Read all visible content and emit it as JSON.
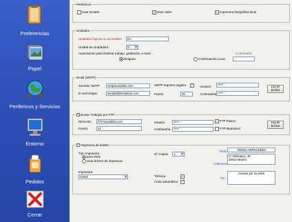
{
  "sidebar": {
    "items": [
      {
        "label": "Preferencias"
      },
      {
        "label": "Papel"
      },
      {
        "label": "Perifericos y Servicios"
      },
      {
        "label": "Entorno"
      },
      {
        "label": "Pedidos"
      },
      {
        "label": "Cerrar"
      }
    ]
  },
  "perifericos": {
    "title": "Perifericos",
    "usar_teclado": "Usar teclado",
    "usar_raton": "Usar ratón",
    "impresora_foto": "Impresora fotográfica local"
  },
  "unidades": {
    "title": "Unidades",
    "logicas_label": "Unidades lógicas no accesibles",
    "logicas_value": "EA",
    "grabadora_label": "Unidad de Grabadora",
    "grabadora_value": "D",
    "autorizacion_label": "Autorización para finalizar trabajo, grabación, e-mail....",
    "contrasena_label": "Contraseña",
    "ninguna": "Ninguna",
    "confirmacion": "Confirmación Local"
  },
  "email": {
    "title": "Email (SMTP)",
    "servidor_label": "Servidor SMTP",
    "servidor_value": "smtp.tiendafoto.com",
    "smtp_req_label": "SMTP requiere registro",
    "usuario_label": "Usuario",
    "usuario_value": "*****",
    "email_origen_label": "E-mail Origen",
    "email_origen_value": "tiendaft@tiendafoto.com",
    "puerto_label": "Puerto",
    "puerto_value": "25",
    "contrasena_label": "Contraseña",
    "contrasena_value": "*****",
    "log_button": "Log de Envíos"
  },
  "ftp": {
    "title": "Enviar Trabajos por FTP",
    "direccion_label": "Dirección",
    "direccion_value": "FTP.tiendafoto.com",
    "usuario_label": "Usuario",
    "usuario_value": "*****",
    "puerto_label": "Puerto",
    "puerto_value": "21",
    "contrasena_label": "Contraseña",
    "contrasena_value": "*****",
    "pasivo": "FTP Pasivo",
    "modelocol": "FTP ModoNocl",
    "log_button": "Log de Envíos"
  },
  "tickets": {
    "title": "Impresora de tickets",
    "tipo_label": "Tipo Impresora",
    "escpos": "ESC POS",
    "drivers": "Usar drivers de impresora",
    "ncopias_label": "Nº Copias",
    "ncopias_value": "1",
    "titulo_label": "Título",
    "titulo_value": "TIENDA HERNÁNDEZ",
    "cabecera_label": "Cabecera",
    "cabecera_lines": [
      "C/ Velázquez, 35",
      "28012 Madrid"
    ],
    "impresora_label": "Impresora",
    "impresora_value": "COM1",
    "termica": "Térmica",
    "corte": "Corte automático",
    "pie_label": "Pie",
    "pie_value": "Gracias por su visita"
  }
}
